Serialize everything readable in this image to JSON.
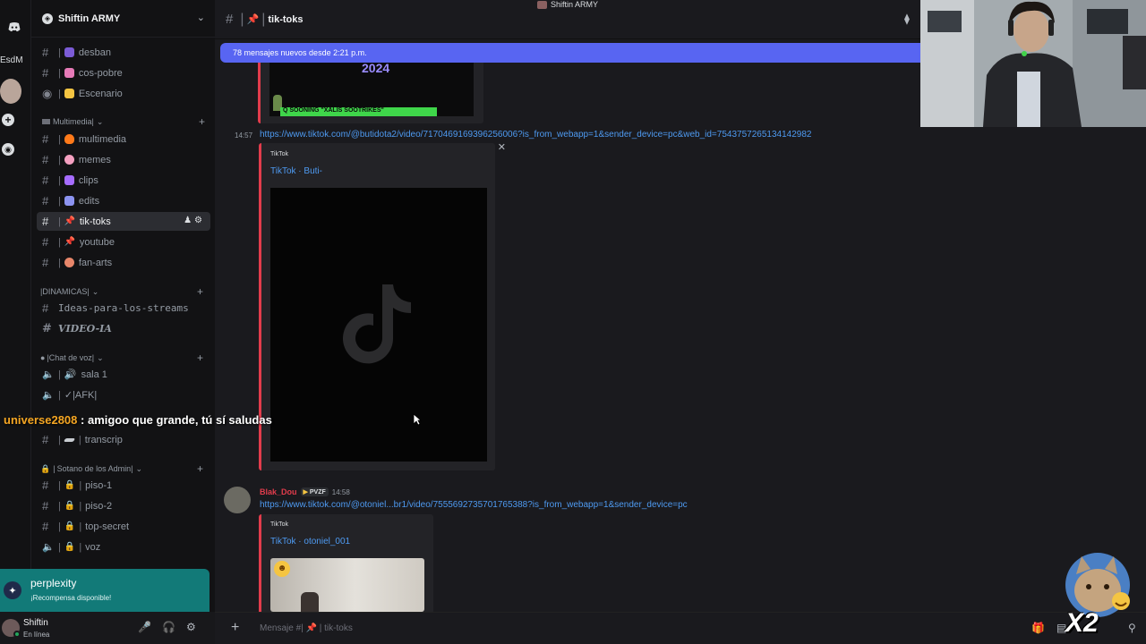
{
  "stream": {
    "title": "Shiftin ARMY"
  },
  "rail": {
    "label": "EsdM"
  },
  "server": {
    "name": "Shiftin ARMY"
  },
  "channels_top": [
    {
      "name": "desban",
      "emoji_color": "#7b5bd6"
    },
    {
      "name": "cos-pobre",
      "emoji_color": "#e67ab7"
    },
    {
      "name": "Escenario",
      "emoji_color": "#f5c542"
    }
  ],
  "category_multimedia": {
    "label": "Multimedia|"
  },
  "channels_multimedia": [
    {
      "name": "multimedia",
      "emoji_color": "#ff7a1a"
    },
    {
      "name": "memes",
      "emoji_color": "#f4a0c0"
    },
    {
      "name": "clips",
      "emoji_color": "#a66cff"
    },
    {
      "name": "edits",
      "emoji_color": "#8c93f0"
    },
    {
      "name": "tik-toks",
      "emoji_color": "#e23c4c"
    },
    {
      "name": "youtube",
      "emoji_color": "#e23c4c"
    },
    {
      "name": "fan-arts",
      "emoji_color": "#e8866a"
    }
  ],
  "category_dinamicas": {
    "label": "|DINAMICAS|"
  },
  "channels_dinamicas": [
    {
      "name": "Ideas-para-los-streams"
    },
    {
      "name": "VIDEO-IA"
    }
  ],
  "category_voz": {
    "label": "|Chat de voz|"
  },
  "channels_voz": [
    {
      "name": "sala 1"
    },
    {
      "name": "✓|AFK|"
    }
  ],
  "channel_transcrip": {
    "name": "transcrip"
  },
  "category_admin": {
    "label": "Sotano de los Admin|"
  },
  "channels_admin": [
    {
      "name": "piso-1"
    },
    {
      "name": "piso-2"
    },
    {
      "name": "top-secret"
    },
    {
      "name": "voz"
    }
  ],
  "overlay_chat": {
    "user": "universe2808",
    "message": " : amigoo que grande, tú sí saludas"
  },
  "perplexity": {
    "title": "perplexity",
    "subtitle": "¡Recompensa disponible!"
  },
  "user": {
    "name": "Shiftin",
    "status": "En línea"
  },
  "topbar": {
    "channel": "tik-toks"
  },
  "new_messages": "78 mensajes nuevos desde 2:21 p.m.",
  "embed_top": {
    "title_text": "2024",
    "banner_text": "Q SOONING \"XALIS SOOTRIKES\""
  },
  "message1": {
    "time": "14:57",
    "link": "https://www.tiktok.com/@butidota2/video/7170469169396256006?is_from_webapp=1&sender_device=pc&web_id=7543757265134142982",
    "embed_provider": "TikTok",
    "embed_title": "TikTok · Buti-"
  },
  "message2": {
    "author": "Blak_Dou",
    "tag": "PVZF",
    "time": "14:58",
    "link": "https://www.tiktok.com/@otoniel...br1/video/7555692735701765388?is_from_webapp=1&sender_device=pc",
    "embed_provider": "TikTok",
    "embed_title": "TikTok · otoniel_001"
  },
  "composer": {
    "placeholder": "Mensaje #",
    "channel": "tik-toks"
  },
  "sticker": {
    "label": "X2"
  },
  "icons": {
    "discord": "discord-icon",
    "add": "plus-icon",
    "explore": "compass-icon",
    "hash": "hash-icon",
    "speaker": "speaker-icon",
    "lock": "lock-icon",
    "mic": "mic-icon",
    "headphones": "headphones-icon",
    "gear": "gear-icon"
  }
}
